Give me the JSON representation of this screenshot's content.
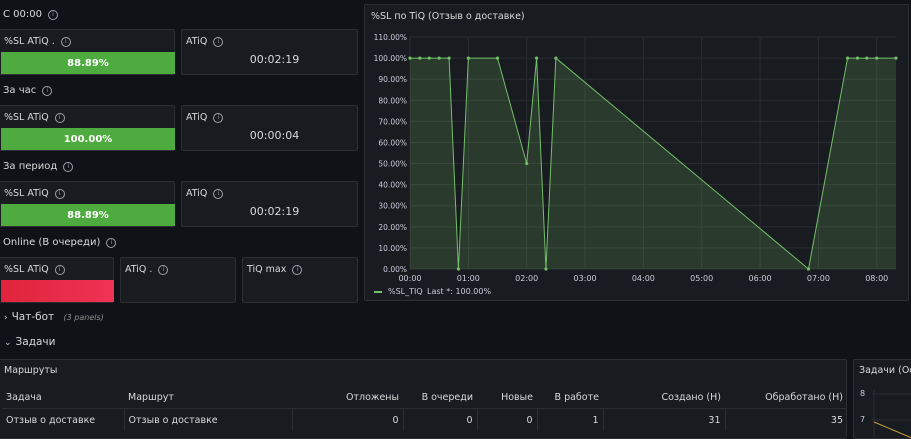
{
  "sections": {
    "s1": "С 00:00",
    "s2": "За час",
    "s3": "За период",
    "s4": "Online (В очереди)"
  },
  "panels": {
    "p1": {
      "title": "%SL ATiQ .",
      "value": "88.89%"
    },
    "p2": {
      "title": "ATiQ",
      "value": "00:02:19"
    },
    "p3": {
      "title": "%SL ATiQ",
      "value": "100.00%"
    },
    "p4": {
      "title": "ATiQ",
      "value": "00:00:04"
    },
    "p5": {
      "title": "%SL ATiQ",
      "value": "88.89%"
    },
    "p6": {
      "title": "ATiQ",
      "value": "00:02:19"
    },
    "p7": {
      "title": "%SL ATiQ"
    },
    "p8": {
      "title": "ATiQ ."
    },
    "p9": {
      "title": "TiQ max"
    }
  },
  "chart_panel": {
    "title": "%SL по TiQ (Отзыв о доставке)"
  },
  "rows": {
    "chatbot": {
      "label": "Чат-бот",
      "hint": "(3 panels)"
    },
    "tasks": {
      "label": "Задачи"
    }
  },
  "routes": {
    "title": "Маршруты",
    "headers": [
      "Задача",
      "Маршрут",
      "Отложены",
      "В очереди",
      "Новые",
      "В работе",
      "Создано (Н)",
      "Обработано (Н)"
    ],
    "rows": [
      [
        "Отзыв о доставке",
        "Отзыв о доставке",
        "0",
        "0",
        "0",
        "1",
        "31",
        "35"
      ]
    ]
  },
  "tasks_panel": {
    "title": "Задачи (Ос",
    "y_ticks": [
      "8",
      "7"
    ]
  },
  "colors": {
    "green": "#73bf69",
    "bar_green": "#4eab3f",
    "red": "#e0243c",
    "background": "#111217"
  },
  "chart_data": {
    "type": "area",
    "title": "%SL по TiQ (Отзыв о доставке)",
    "x_ticks": [
      "00:00",
      "01:00",
      "02:00",
      "03:00",
      "04:00",
      "05:00",
      "06:00",
      "07:00",
      "08:00"
    ],
    "y_ticks": [
      "0.00%",
      "10.00%",
      "20.00%",
      "30.00%",
      "40.00%",
      "50.00%",
      "60.00%",
      "70.00%",
      "80.00%",
      "90.00%",
      "100.00%",
      "110.00%"
    ],
    "ylim": [
      0,
      110
    ],
    "xlim": [
      0,
      8.33
    ],
    "grid": true,
    "legend_position": "bottom-left",
    "series": [
      {
        "name": "%SL_TiQ",
        "legend": "%SL_TIQ",
        "legend_stat": "Last *: 100.00%",
        "x": [
          0.0,
          0.17,
          0.33,
          0.5,
          0.67,
          0.83,
          1.0,
          1.5,
          2.0,
          2.17,
          2.33,
          2.5,
          6.83,
          7.5,
          7.67,
          7.83,
          8.0,
          8.33
        ],
        "y": [
          100,
          100,
          100,
          100,
          100,
          0,
          100,
          100,
          50,
          100,
          0,
          100,
          0,
          100,
          100,
          100,
          100,
          100
        ]
      }
    ]
  }
}
